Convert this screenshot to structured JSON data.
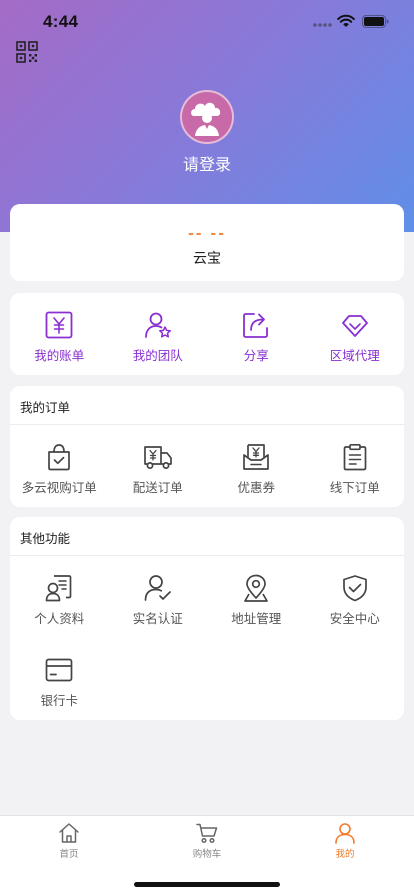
{
  "status_bar": {
    "time": "4:44"
  },
  "header": {
    "login_prompt": "请登录"
  },
  "yunbao": {
    "value": "-- --",
    "label": "云宝"
  },
  "quick_actions": [
    {
      "label": "我的账单",
      "icon": "yuan-bill-icon"
    },
    {
      "label": "我的团队",
      "icon": "team-icon"
    },
    {
      "label": "分享",
      "icon": "share-icon"
    },
    {
      "label": "区域代理",
      "icon": "diamond-icon"
    }
  ],
  "orders": {
    "title": "我的订单",
    "items": [
      {
        "label": "多云视购订单",
        "icon": "shopping-bag-icon"
      },
      {
        "label": "配送订单",
        "icon": "delivery-truck-icon"
      },
      {
        "label": "优惠券",
        "icon": "coupon-icon"
      },
      {
        "label": "线下订单",
        "icon": "clipboard-icon"
      }
    ]
  },
  "other": {
    "title": "其他功能",
    "items": [
      {
        "label": "个人资料",
        "icon": "profile-card-icon"
      },
      {
        "label": "实名认证",
        "icon": "verified-user-icon"
      },
      {
        "label": "地址管理",
        "icon": "location-pin-icon"
      },
      {
        "label": "安全中心",
        "icon": "shield-check-icon"
      },
      {
        "label": "银行卡",
        "icon": "bank-card-icon"
      }
    ]
  },
  "tabbar": {
    "tabs": [
      {
        "label": "首页",
        "icon": "home-icon",
        "active": false
      },
      {
        "label": "购物车",
        "icon": "cart-icon",
        "active": false
      },
      {
        "label": "我的",
        "icon": "person-icon",
        "active": true
      }
    ]
  },
  "colors": {
    "header_gradient_start": "#a46bc6",
    "header_gradient_end": "#5f8fe8",
    "quick_action_purple": "#8a2fd1",
    "accent_orange": "#f07a2a"
  }
}
